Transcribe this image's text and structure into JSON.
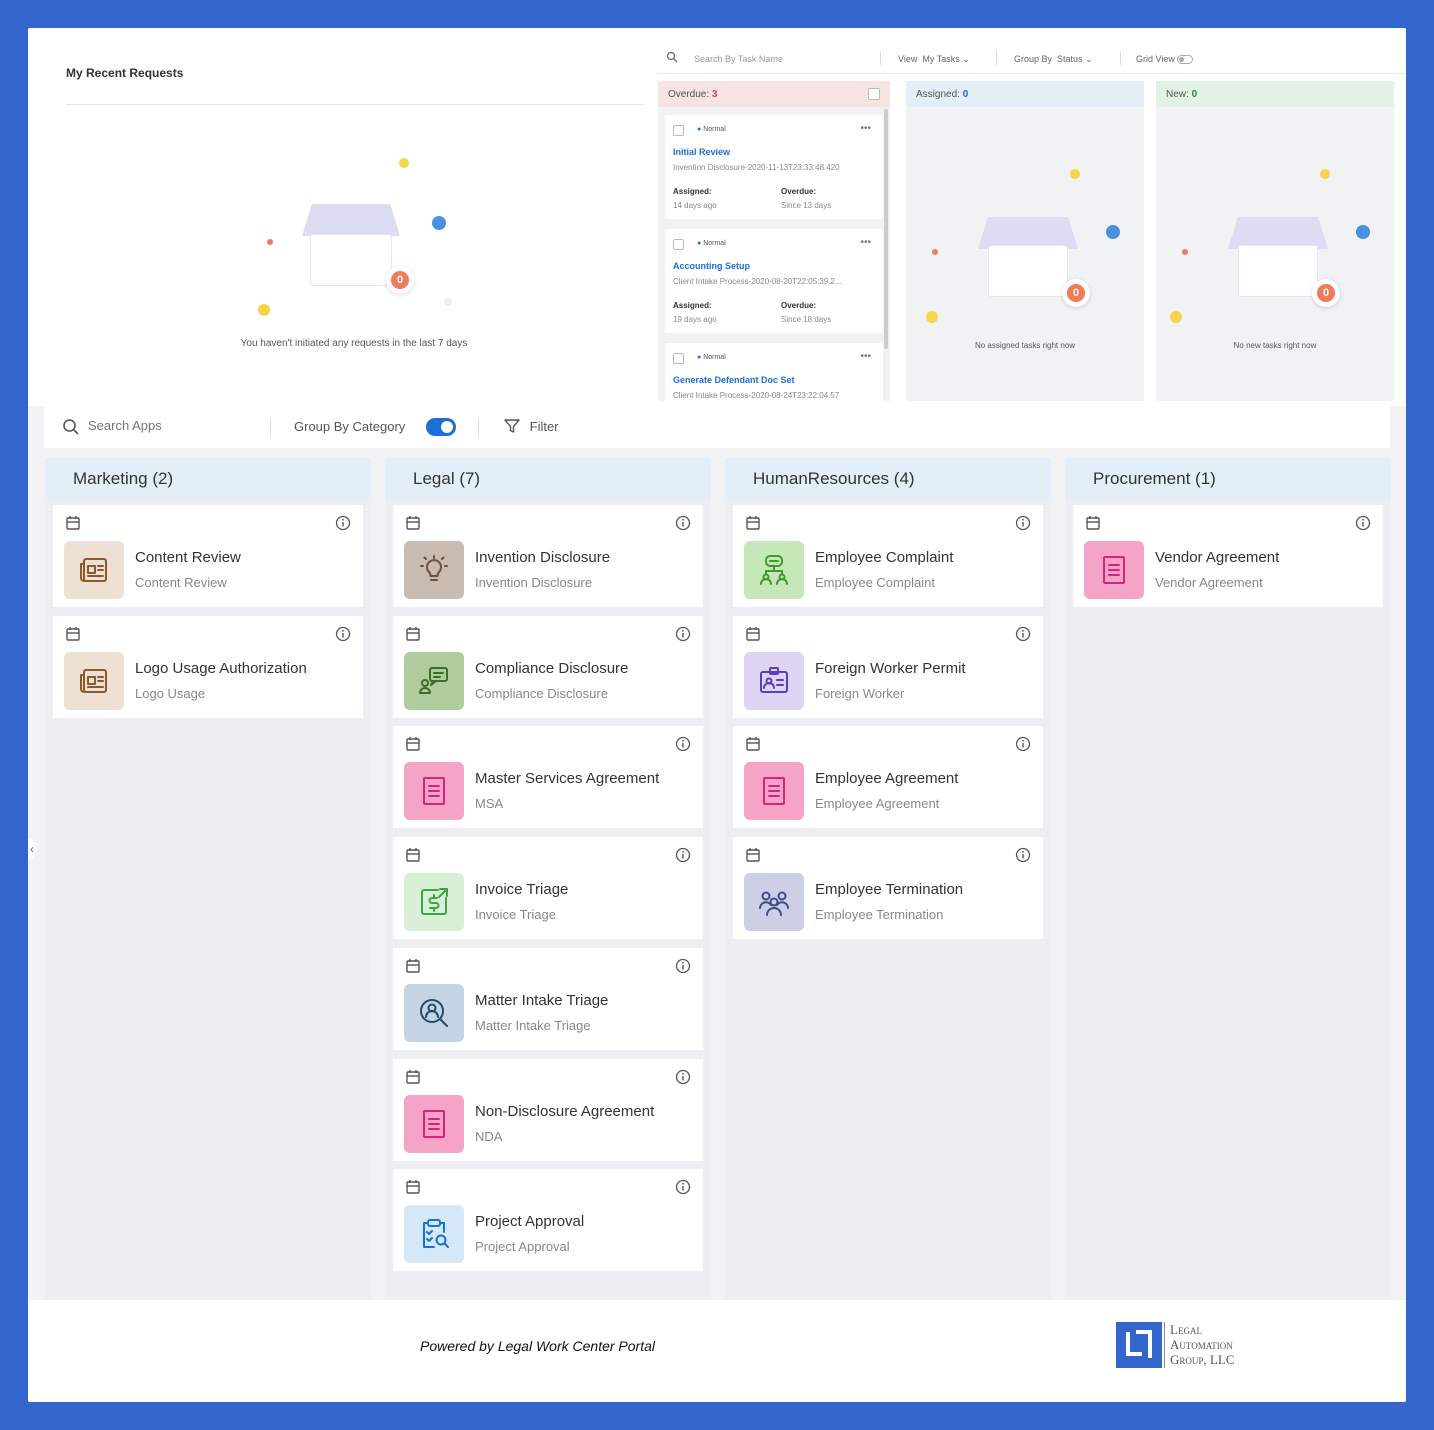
{
  "recent": {
    "title": "My Recent Requests",
    "empty_message": "You haven't initiated any requests in the last 7 days",
    "badge_count": "0"
  },
  "task_toolbar": {
    "search_placeholder": "Search By Task Name",
    "view_label": "View",
    "view_value": "My Tasks",
    "group_label": "Group By",
    "group_value": "Status",
    "grid_label": "Grid View"
  },
  "task_columns": [
    {
      "label": "Overdue:",
      "count": "3",
      "color": "#e0413a",
      "bg": "#f6e3e3",
      "tasks": [
        {
          "priority": "Normal",
          "name": "Initial Review",
          "process": "Invention Disclosure-2020-11-13T23:33:48.420",
          "assigned_label": "Assigned:",
          "assigned_value": "14 days ago",
          "overdue_label": "Overdue:",
          "overdue_value": "Since 13 days"
        },
        {
          "priority": "Normal",
          "name": "Accounting Setup",
          "process": "Client Intake Process-2020-08-20T22:05:39.2...",
          "assigned_label": "Assigned:",
          "assigned_value": "19 days ago",
          "overdue_label": "Overdue:",
          "overdue_value": "Since 18 days"
        },
        {
          "priority": "Normal",
          "name": "Generate Defendant Doc Set",
          "process": "Client Intake Process-2020-08-24T23:22:04.57",
          "assigned_label": "",
          "assigned_value": "",
          "overdue_label": "",
          "overdue_value": ""
        }
      ]
    },
    {
      "label": "Assigned:",
      "count": "0",
      "color": "#1b6fd6",
      "bg": "#e3eef8",
      "empty_message": "No assigned tasks right now",
      "badge_count": "0"
    },
    {
      "label": "New:",
      "count": "0",
      "color": "#1d8f3f",
      "bg": "#e3f1e6",
      "empty_message": "No new tasks right now",
      "badge_count": "0"
    }
  ],
  "app_toolbar": {
    "search_placeholder": "Search Apps",
    "group_label": "Group By Category",
    "filter_label": "Filter"
  },
  "categories": [
    {
      "title": "Marketing (2)",
      "apps": [
        {
          "title": "Content Review",
          "sub": "Content Review",
          "icon": "newspaper-icon",
          "icon_bg": "#eee1d3",
          "icon_color": "#8a5a2b"
        },
        {
          "title": "Logo Usage Authorization",
          "sub": "Logo Usage",
          "icon": "newspaper-icon",
          "icon_bg": "#eee1d3",
          "icon_color": "#8a5a2b"
        }
      ]
    },
    {
      "title": "Legal (7)",
      "apps": [
        {
          "title": "Invention Disclosure",
          "sub": "Invention Disclosure",
          "icon": "lightbulb-icon",
          "icon_bg": "#c9bbb0",
          "icon_color": "#6b5240"
        },
        {
          "title": "Compliance Disclosure",
          "sub": "Compliance Disclosure",
          "icon": "chat-person-icon",
          "icon_bg": "#aecc9c",
          "icon_color": "#3f6b2c"
        },
        {
          "title": "Master Services Agreement",
          "sub": "MSA",
          "icon": "document-icon",
          "icon_bg": "#f5a3c7",
          "icon_color": "#d6247b"
        },
        {
          "title": "Invoice Triage",
          "sub": "Invoice Triage",
          "icon": "dollar-icon",
          "icon_bg": "#d9f0d6",
          "icon_color": "#3aa541"
        },
        {
          "title": "Matter Intake Triage",
          "sub": "Matter Intake Triage",
          "icon": "search-person-icon",
          "icon_bg": "#c4d4e2",
          "icon_color": "#254a6b"
        },
        {
          "title": "Non-Disclosure Agreement",
          "sub": "NDA",
          "icon": "document-icon",
          "icon_bg": "#f5a3c7",
          "icon_color": "#d6247b"
        },
        {
          "title": "Project Approval",
          "sub": "Project Approval",
          "icon": "clipboard-search-icon",
          "icon_bg": "#d5e8f7",
          "icon_color": "#1b6fd6"
        }
      ]
    },
    {
      "title": "HumanResources (4)",
      "apps": [
        {
          "title": "Employee Complaint",
          "sub": "Employee Complaint",
          "icon": "people-chat-icon",
          "icon_bg": "#c6e8b8",
          "icon_color": "#3f9a2c"
        },
        {
          "title": "Foreign Worker Permit",
          "sub": "Foreign Worker",
          "icon": "id-card-icon",
          "icon_bg": "#ddd3f3",
          "icon_color": "#5b3fb8"
        },
        {
          "title": "Employee Agreement",
          "sub": "Employee Agreement",
          "icon": "document-icon",
          "icon_bg": "#f5a3c7",
          "icon_color": "#d6247b"
        },
        {
          "title": "Employee Termination",
          "sub": "Employee Termination",
          "icon": "group-icon",
          "icon_bg": "#cdcfe6",
          "icon_color": "#3f4a8a"
        }
      ]
    },
    {
      "title": "Procurement (1)",
      "apps": [
        {
          "title": "Vendor Agreement",
          "sub": "Vendor Agreement",
          "icon": "document-icon",
          "icon_bg": "#f5a3c7",
          "icon_color": "#d6247b"
        }
      ]
    }
  ],
  "footer": {
    "powered_by": "Powered by Legal Work Center Portal",
    "logo_line1": "Legal",
    "logo_line2": "Automation",
    "logo_line3": "Group, LLC"
  }
}
